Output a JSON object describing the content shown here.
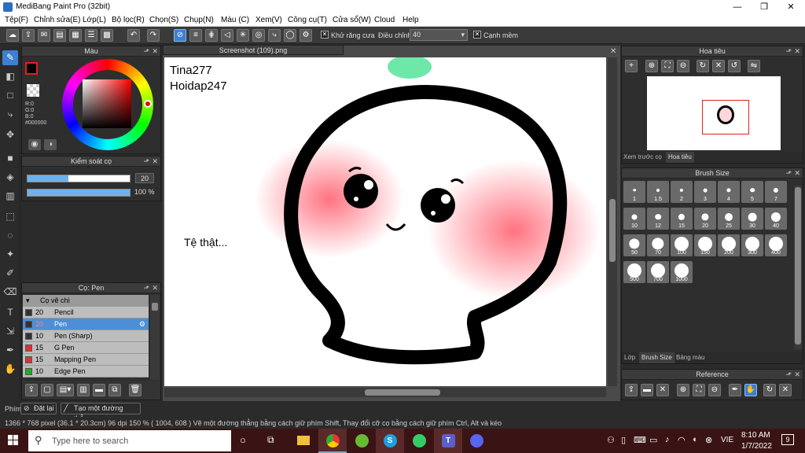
{
  "window": {
    "title": "MediBang Paint Pro (32bit)",
    "minimize": "—",
    "maximize": "❐",
    "close": "✕"
  },
  "menu": [
    "Tệp(F)",
    "Chỉnh sửa(E)",
    "Lớp(L)",
    "Bộ lọc(R)",
    "Chọn(S)",
    "Chụp(N)",
    "Màu (C)",
    "Xem(V)",
    "Công cụ(T)",
    "Cửa sổ(W)",
    "Cloud",
    "Help"
  ],
  "toolbar": {
    "antialias_label": "Khử răng cưa",
    "adjust_label": "Điều chỉnh",
    "adjust_value": "40",
    "edge_label": "Cạnh mềm"
  },
  "color_panel": {
    "title": "Màu",
    "r": "R:0",
    "g": "G:0",
    "b": "B:0",
    "hex": "#000000"
  },
  "brush_control": {
    "title": "Kiểm soát cọ",
    "size": "20",
    "opacity": "100 %",
    "size_fraction": 0.4,
    "opacity_fraction": 1.0
  },
  "brush_panel": {
    "title": "Cọ: Pen",
    "group": "Cọ vẽ chì",
    "items": [
      {
        "size": "20",
        "name": "Pencil",
        "color": "#333333"
      },
      {
        "size": "20",
        "name": "Pen",
        "color": "#333333",
        "selected": true
      },
      {
        "size": "10",
        "name": "Pen (Sharp)",
        "color": "#333333"
      },
      {
        "size": "15",
        "name": "G Pen",
        "color": "#e03030"
      },
      {
        "size": "15",
        "name": "Mapping Pen",
        "color": "#e03030"
      },
      {
        "size": "10",
        "name": "Edge Pen",
        "color": "#22aa22"
      }
    ]
  },
  "document": {
    "tab": "Screenshot (109).png",
    "text1": "Tina277",
    "text2": "Hoidap247",
    "text3": "Tệ thật..."
  },
  "navigator": {
    "title": "Hoa tiêu",
    "tab1": "Xem trước cọ",
    "tab2": "Hoa tiêu"
  },
  "brush_size": {
    "title": "Brush Size",
    "sizes": [
      "1",
      "1.5",
      "2",
      "3",
      "4",
      "5",
      "7",
      "10",
      "12",
      "15",
      "20",
      "25",
      "30",
      "40",
      "50",
      "70",
      "100",
      "150",
      "200",
      "300",
      "400",
      "500",
      "700",
      "1000"
    ],
    "tabs": [
      "Lớp",
      "Brush Size",
      "Bảng màu"
    ]
  },
  "reference": {
    "title": "Reference"
  },
  "status": {
    "phim": "Phím",
    "reset": "Đặt lại",
    "line": "Tạo một đường thẳng"
  },
  "info": "1366 * 768 pixel   (36.1 * 20.3cm)   96 dpi   150 %   ( 1004, 608 )   Vẽ một đường thẳng bằng cách giữ phím Shift, Thay đổi cỡ cọ bằng cách giữ phím Ctrl, Alt và kéo",
  "taskbar": {
    "search_placeholder": "Type here to search",
    "lang": "VIE",
    "time": "8:10 AM",
    "date": "1/7/2022",
    "notif": "9"
  }
}
